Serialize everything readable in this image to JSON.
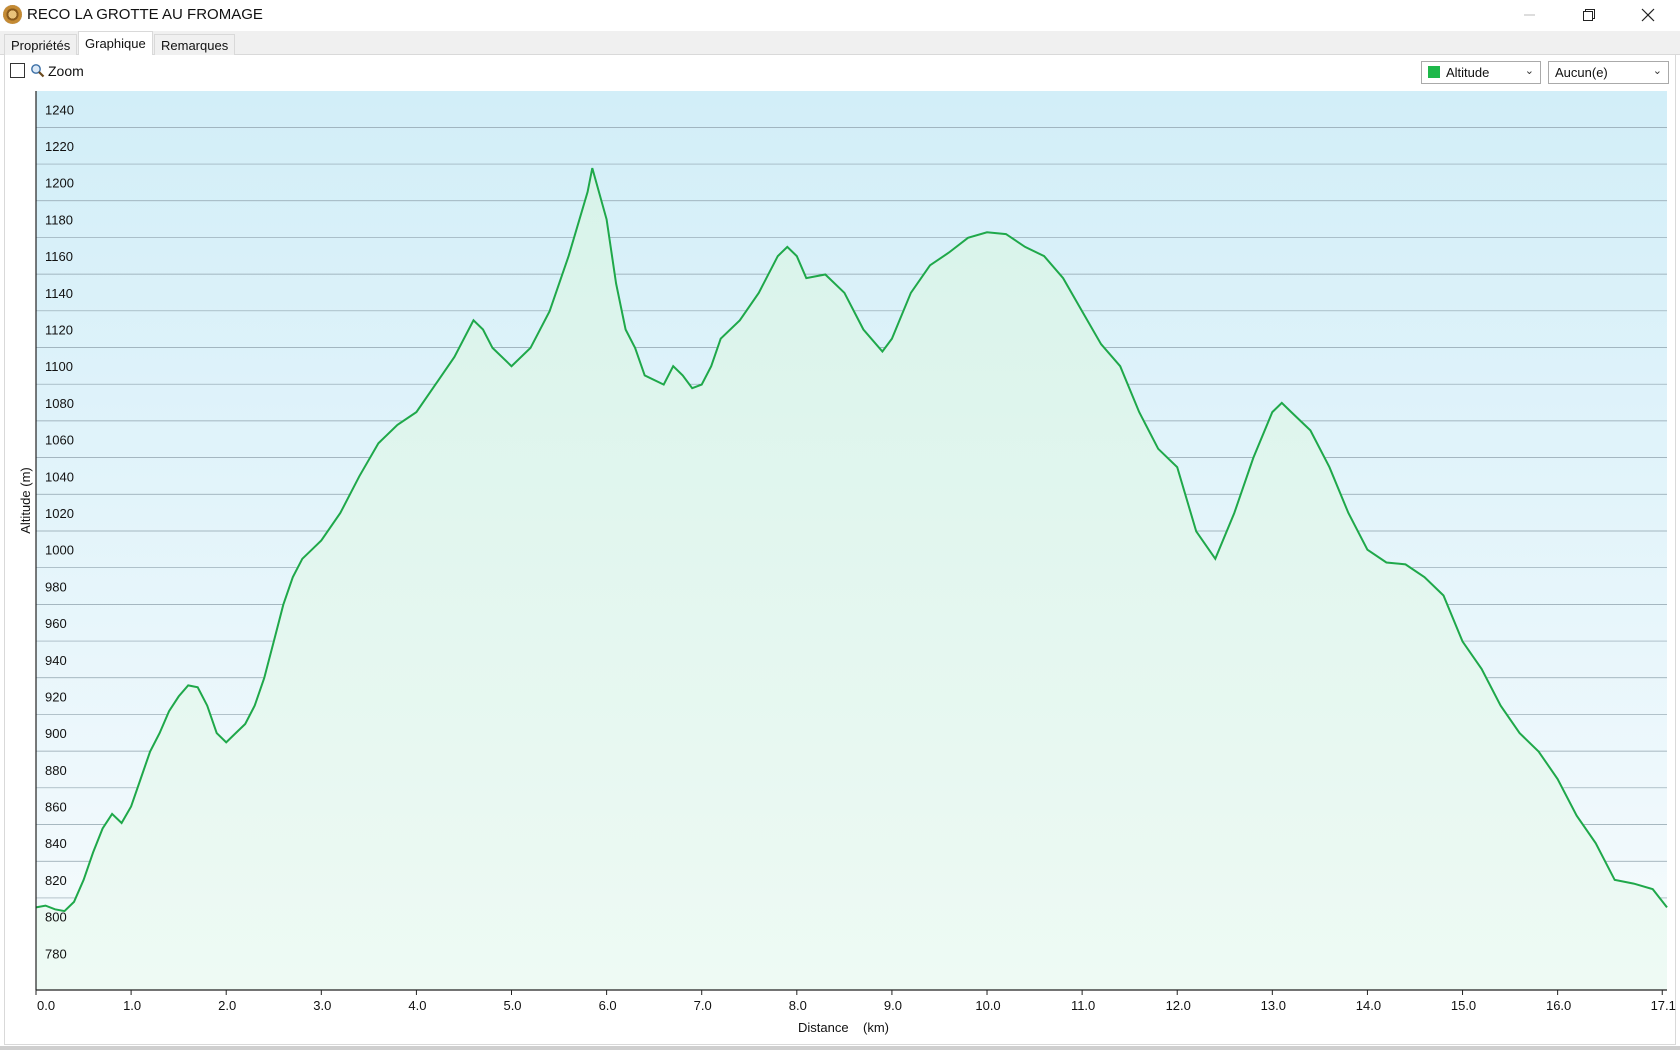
{
  "window": {
    "title": "RECO LA GROTTE AU FROMAGE",
    "minimize_icon": "minimize-icon",
    "restore_icon": "restore-icon",
    "close_icon": "close-icon"
  },
  "tabs": [
    {
      "label": "Propriétés",
      "active": false
    },
    {
      "label": "Graphique",
      "active": true
    },
    {
      "label": "Remarques",
      "active": false
    }
  ],
  "toolbar": {
    "zoom_label": "Zoom",
    "zoom_checked": false,
    "series_select": {
      "value": "Altitude",
      "color": "#1eb84a"
    },
    "overlay_select": {
      "value": "Aucun(e)"
    }
  },
  "chart_data": {
    "type": "area",
    "xlabel": "Distance    (km)",
    "ylabel": "Altitude (m)",
    "xlim": [
      0,
      17.15
    ],
    "ylim": [
      760,
      1250
    ],
    "x_ticks": [
      "0.0",
      "1.0",
      "2.0",
      "3.0",
      "4.0",
      "5.0",
      "6.0",
      "7.0",
      "8.0",
      "9.0",
      "10.0",
      "11.0",
      "12.0",
      "13.0",
      "14.0",
      "15.0",
      "16.0",
      "17.1"
    ],
    "x_tick_values": [
      0,
      1,
      2,
      3,
      4,
      5,
      6,
      7,
      8,
      9,
      10,
      11,
      12,
      13,
      14,
      15,
      16,
      17.1
    ],
    "y_ticks": [
      780,
      800,
      820,
      840,
      860,
      880,
      900,
      920,
      940,
      960,
      980,
      1000,
      1020,
      1040,
      1060,
      1080,
      1100,
      1120,
      1140,
      1160,
      1180,
      1200,
      1220,
      1240
    ],
    "grid": true,
    "line_color": "#1fa84a",
    "series": [
      {
        "x": [
          0,
          0.1,
          0.2,
          0.3,
          0.4,
          0.5,
          0.6,
          0.7,
          0.8,
          0.9,
          1.0,
          1.1,
          1.2,
          1.3,
          1.4,
          1.5,
          1.6,
          1.7,
          1.8,
          1.9,
          2.0,
          2.1,
          2.2,
          2.3,
          2.4,
          2.5,
          2.6,
          2.7,
          2.8,
          2.9,
          3.0,
          3.2,
          3.4,
          3.6,
          3.8,
          4.0,
          4.2,
          4.4,
          4.6,
          4.7,
          4.8,
          5.0,
          5.2,
          5.4,
          5.6,
          5.8,
          5.85,
          6.0,
          6.1,
          6.2,
          6.3,
          6.4,
          6.6,
          6.7,
          6.8,
          6.9,
          7.0,
          7.1,
          7.2,
          7.4,
          7.6,
          7.8,
          7.9,
          8.0,
          8.1,
          8.3,
          8.5,
          8.7,
          8.9,
          9.0,
          9.2,
          9.4,
          9.6,
          9.8,
          10.0,
          10.2,
          10.4,
          10.6,
          10.8,
          11.0,
          11.2,
          11.4,
          11.6,
          11.8,
          12.0,
          12.2,
          12.4,
          12.6,
          12.8,
          13.0,
          13.1,
          13.2,
          13.4,
          13.6,
          13.8,
          14.0,
          14.2,
          14.4,
          14.6,
          14.8,
          15.0,
          15.2,
          15.4,
          15.6,
          15.8,
          16.0,
          16.2,
          16.4,
          16.6,
          16.8,
          17.0,
          17.15
        ],
        "values": [
          805,
          806,
          804,
          803,
          808,
          820,
          835,
          848,
          856,
          851,
          860,
          875,
          890,
          900,
          912,
          920,
          926,
          925,
          915,
          900,
          895,
          900,
          905,
          915,
          930,
          950,
          970,
          985,
          995,
          1000,
          1005,
          1020,
          1040,
          1058,
          1068,
          1075,
          1090,
          1105,
          1125,
          1120,
          1110,
          1100,
          1110,
          1130,
          1160,
          1195,
          1208,
          1180,
          1145,
          1120,
          1110,
          1095,
          1090,
          1100,
          1095,
          1088,
          1090,
          1100,
          1115,
          1125,
          1140,
          1160,
          1165,
          1160,
          1148,
          1150,
          1140,
          1120,
          1108,
          1115,
          1140,
          1155,
          1162,
          1170,
          1173,
          1172,
          1165,
          1160,
          1148,
          1130,
          1112,
          1100,
          1075,
          1055,
          1045,
          1010,
          995,
          1020,
          1050,
          1075,
          1080,
          1075,
          1065,
          1045,
          1020,
          1000,
          993,
          992,
          985,
          975,
          950,
          935,
          915,
          900,
          890,
          875,
          855,
          840,
          820,
          818,
          815,
          805
        ]
      }
    ]
  }
}
